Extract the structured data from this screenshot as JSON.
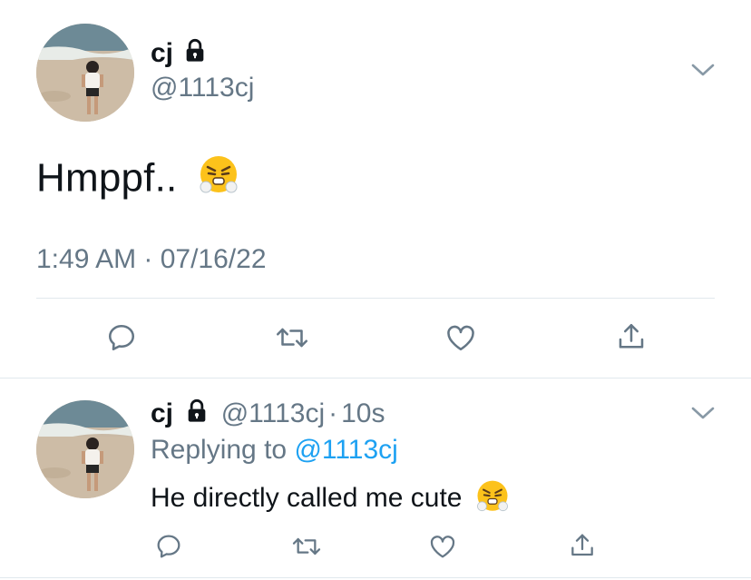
{
  "main_tweet": {
    "author_name": "cj",
    "author_handle": "@1113cj",
    "text": "Hmppf..",
    "emoji": "huffing-face-emoji",
    "timestamp": "1:49 AM · 07/16/22"
  },
  "reply": {
    "author_name": "cj",
    "author_handle": "@1113cj",
    "separator": "·",
    "time_ago": "10s",
    "replying_prefix": "Replying to",
    "replying_to": "@1113cj",
    "text": "He directly called me cute",
    "emoji": "huffing-face-emoji"
  },
  "icons": {
    "lock": "lock-icon",
    "chevron": "chevron-down-icon",
    "reply": "reply-icon",
    "retweet": "retweet-icon",
    "like": "heart-icon",
    "share": "share-icon"
  },
  "colors": {
    "text": "#0f1419",
    "muted": "#657786",
    "link": "#1da1f2",
    "divider": "#e1e8ed",
    "emoji_face": "#fcc21b"
  }
}
